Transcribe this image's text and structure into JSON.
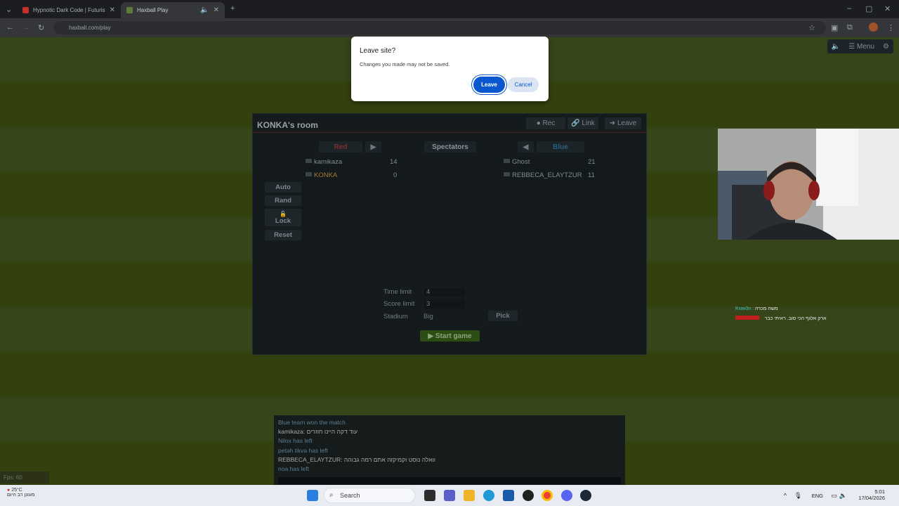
{
  "browser": {
    "tabs": [
      {
        "title": "Hypnotic Dark Code | Futuristic..."
      },
      {
        "title": "Haxball Play"
      }
    ],
    "url": "haxball.com/play"
  },
  "game_menu": {
    "menu_label": "☰ Menu"
  },
  "room": {
    "title": "KONKA's room",
    "header_buttons": {
      "rec": "● Rec",
      "link": "🔗 Link",
      "leave": "➜ Leave"
    },
    "columns": {
      "red": "Red",
      "spectators": "Spectators",
      "blue": "Blue"
    },
    "red_players": [
      {
        "name": "kamikaza",
        "score": "14"
      },
      {
        "name": "KONKA",
        "score": "0"
      }
    ],
    "blue_players": [
      {
        "name": "Ghost",
        "score": "21"
      },
      {
        "name": "REBBECA_ELAYTZUR",
        "score": "11"
      }
    ],
    "side_buttons": {
      "auto": "Auto",
      "rand": "Rand",
      "lock": "Lock",
      "reset": "Reset"
    },
    "settings": {
      "time_limit_label": "Time limit",
      "time_limit_value": "4",
      "score_limit_label": "Score limit",
      "score_limit_value": "3",
      "stadium_label": "Stadium",
      "stadium_value": "Big",
      "pick": "Pick"
    },
    "start_game": "▶ Start game"
  },
  "overlay_chat": [
    {
      "user": "Krav0n :",
      "text": "משה מכרה"
    },
    {
      "user": "‎‎‎‎ :",
      "text": "ארק אלגף הכי סוב. ראיתי כבר"
    }
  ],
  "chat": {
    "lines": [
      {
        "text": "Blue team won the match",
        "color": "#5b7e8f"
      },
      {
        "text": "kamikaza: עוד דקה היינו חוזרים",
        "color": "#a4aaa8"
      },
      {
        "text": "Nilox has left",
        "color": "#5b7e8f"
      },
      {
        "text": "petah tikva has left",
        "color": "#5b7e8f"
      },
      {
        "text": "REBBECA_ELAYTZUR: וואלה נוסט וקמיקזה אתם רמה גבוהה",
        "color": "#a4aaa8"
      },
      {
        "text": "noa has left",
        "color": "#5b7e8f"
      }
    ]
  },
  "fps": "Fps: 60",
  "dialog": {
    "title": "Leave site?",
    "message": "Changes you made may not be saved.",
    "leave": "Leave",
    "cancel": "Cancel"
  },
  "taskbar": {
    "weather_temp": "25°C",
    "weather_desc": "מעונן רב היום",
    "search": "Search",
    "lang": "ENG",
    "time": "5:01",
    "date": "17/04/2026"
  }
}
